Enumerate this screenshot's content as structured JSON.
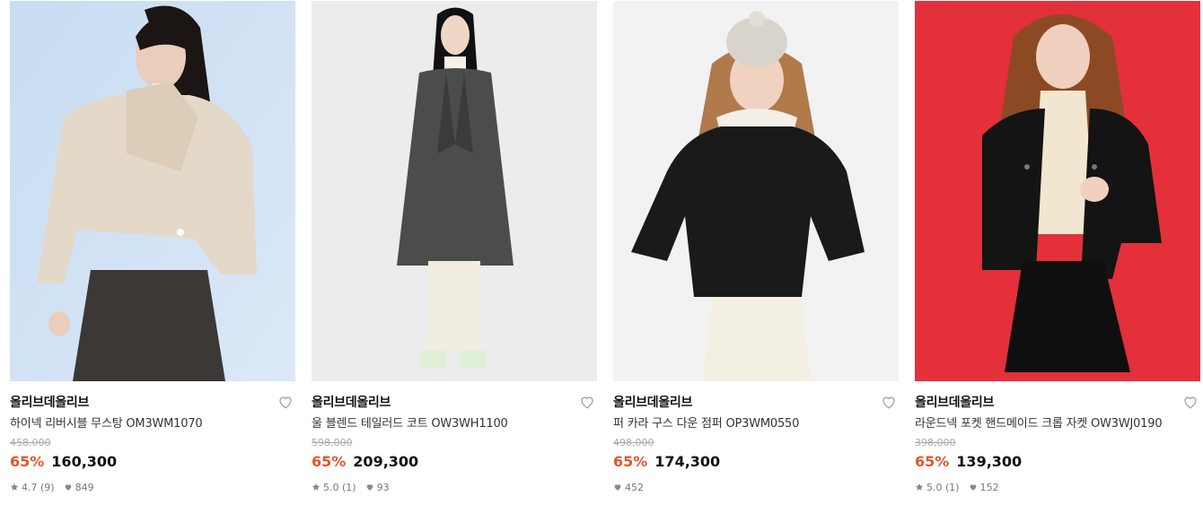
{
  "products": [
    {
      "brand": "올리브데올리브",
      "name": "하이넥 리버시블 무스탕 OM3WM1070",
      "original_price": "458,000",
      "discount": "65%",
      "price": "160,300",
      "rating": "4.7 (9)",
      "likes": "849",
      "photo_bg": "#cfe0f3"
    },
    {
      "brand": "올리브데올리브",
      "name": "울 블렌드 테일러드 코트 OW3WH1100",
      "original_price": "598,000",
      "discount": "65%",
      "price": "209,300",
      "rating": "5.0 (1)",
      "likes": "93",
      "photo_bg": "#ececec"
    },
    {
      "brand": "올리브데올리브",
      "name": "퍼 카라 구스 다운 점퍼 OP3WM0550",
      "original_price": "498,000",
      "discount": "65%",
      "price": "174,300",
      "rating": "",
      "likes": "452",
      "photo_bg": "#f2f2f2"
    },
    {
      "brand": "올리브데올리브",
      "name": "라운드넥 포켓 핸드메이드 크롭 자켓 OW3WJ0190",
      "original_price": "398,000",
      "discount": "65%",
      "price": "139,300",
      "rating": "5.0 (1)",
      "likes": "152",
      "photo_bg": "#e3303b"
    }
  ],
  "colors": {
    "discount": "#e2572a",
    "original_price": "#aaaaaa",
    "meta": "#777777"
  },
  "icons": {
    "wishlist": "heart-outline-icon",
    "rating": "star-icon",
    "likes": "heart-filled-icon"
  }
}
